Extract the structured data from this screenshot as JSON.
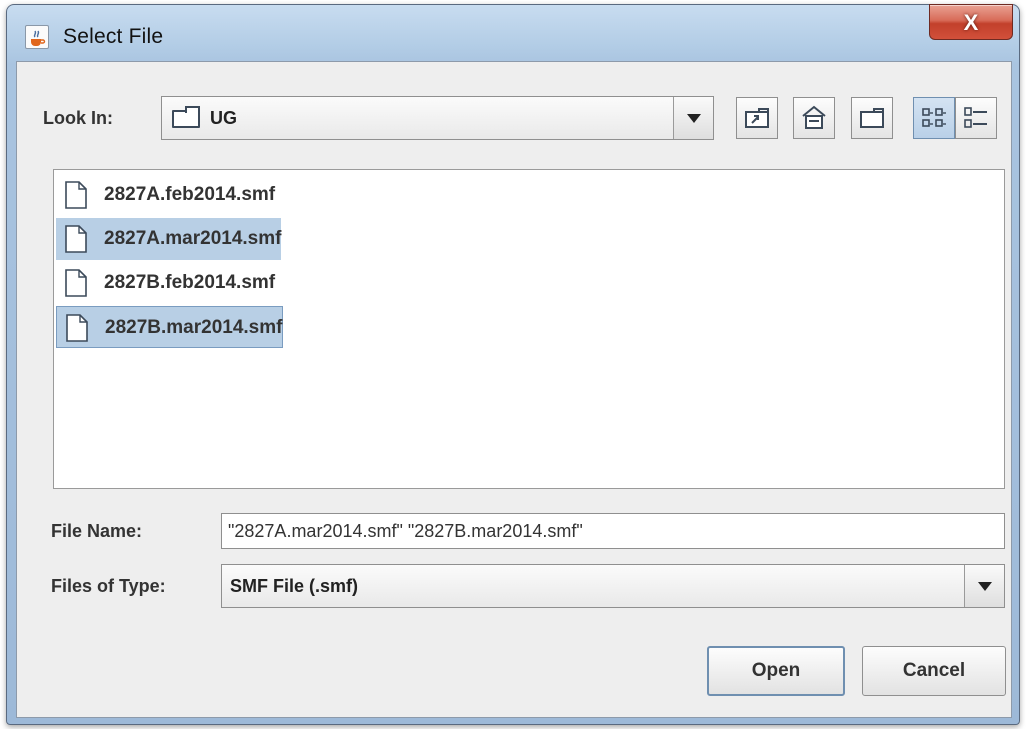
{
  "window": {
    "title": "Select File",
    "close_glyph": "X",
    "icon": "java-cup-icon"
  },
  "look_in": {
    "label": "Look In:",
    "value": "UG",
    "icon": "folder-icon"
  },
  "toolbar": [
    {
      "name": "up-one-level-button",
      "icon": "up-folder-icon",
      "selected": false
    },
    {
      "name": "home-button",
      "icon": "home-icon",
      "selected": false
    },
    {
      "name": "new-folder-button",
      "icon": "new-folder-icon",
      "selected": false
    },
    {
      "name": "list-view-button",
      "icon": "list-view-icon",
      "selected": true
    },
    {
      "name": "details-view-button",
      "icon": "details-view-icon",
      "selected": false
    }
  ],
  "files": [
    {
      "name": "2827A.feb2014.smf",
      "selected": false
    },
    {
      "name": "2827A.mar2014.smf",
      "selected": true
    },
    {
      "name": "2827B.feb2014.smf",
      "selected": false
    },
    {
      "name": "2827B.mar2014.smf",
      "selected": true
    }
  ],
  "file_name": {
    "label": "File Name:",
    "value": "\"2827A.mar2014.smf\" \"2827B.mar2014.smf\""
  },
  "file_type": {
    "label": "Files of Type:",
    "value": "SMF File (.smf)"
  },
  "buttons": {
    "open": "Open",
    "cancel": "Cancel"
  },
  "colors": {
    "selection": "#b8cfe5",
    "title_bar": "#b3cde6",
    "close_button": "#c94a35"
  }
}
